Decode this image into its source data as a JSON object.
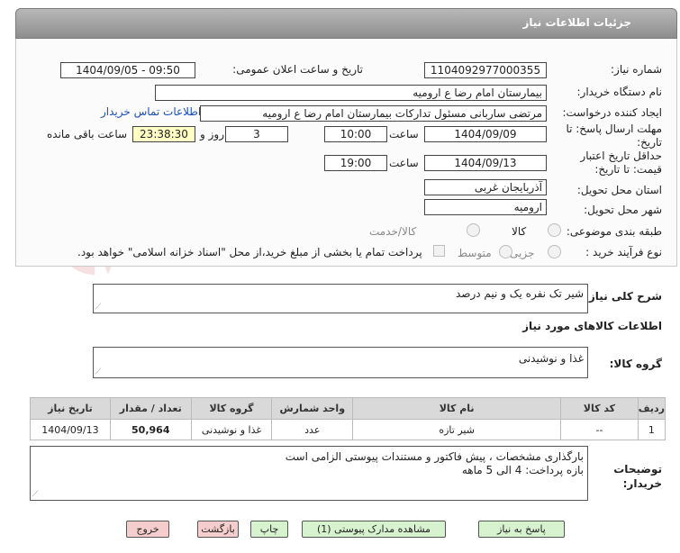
{
  "header": {
    "title": "جزئیات اطلاعات نیاز"
  },
  "fields": {
    "need_number_label": "شماره نیاز:",
    "need_number": "1104092977000355",
    "announce_label": "تاریخ و ساعت اعلان عمومی:",
    "announce_value": "1404/09/05 - 09:50",
    "buyer_org_label": "نام دستگاه خریدار:",
    "buyer_org": "بیمارستان امام رضا  ع  ارومیه",
    "creator_label": "ایجاد کننده درخواست:",
    "creator": "مرتضی ساربانی مسئول تدارکات بیمارستان امام رضا  ع  ارومیه",
    "contact_link": "اطلاعات تماس خریدار",
    "deadline_label_1": "مهلت ارسال پاسخ: تا",
    "deadline_label_2": "تاریخ:",
    "deadline_date": "1404/09/09",
    "time_label": "ساعت",
    "deadline_time": "10:00",
    "days": "3",
    "days_label": "روز و",
    "remaining": "23:38:30",
    "remaining_label": "ساعت باقی مانده",
    "validity_label_1": "حداقل تاریخ اعتبار",
    "validity_label_2": "قیمت: تا تاریخ:",
    "validity_date": "1404/09/13",
    "validity_time": "19:00",
    "province_label": "استان محل تحویل:",
    "province": "آذربایجان غربی",
    "city_label": "شهر محل تحویل:",
    "city": "ارومیه",
    "category_label": "طبقه بندی موضوعی:",
    "category_options": [
      "کالا",
      "کالا/خدمت"
    ],
    "process_label": "نوع فرآیند خرید :",
    "process_options": [
      "جزیی",
      "متوسط"
    ],
    "payment_note": "پرداخت تمام یا بخشی از مبلغ خرید،از محل \"اسناد خزانه اسلامی\" خواهد بود."
  },
  "summary": {
    "label": "شرح کلی نیاز:",
    "text": "شیر تک نفره یک و نیم درصد"
  },
  "goods": {
    "section_title": "اطلاعات کالاهای مورد نیاز",
    "group_label": "گروه کالا:",
    "group_value": "غذا و نوشیدنی"
  },
  "table": {
    "headers": [
      "ردیف",
      "کد کالا",
      "نام کالا",
      "واحد شمارش",
      "گروه کالا",
      "تعداد / مقدار",
      "تاریخ نیاز"
    ],
    "rows": [
      [
        "1",
        "--",
        "شیر تازه",
        "عدد",
        "غذا و نوشیدنی",
        "50,964",
        "1404/09/13"
      ]
    ]
  },
  "notes": {
    "label_1": "توضیحات",
    "label_2": "خریدار:",
    "line1": "بارگذاری مشخصات ، پیش فاکتور و مستندات پیوستی الزامی است",
    "line2": "بازه پرداخت: 4 الی 5 ماهه"
  },
  "buttons": {
    "reply": "پاسخ به نیاز",
    "attachments": "مشاهده مدارک پیوستی (1)",
    "print": "چاپ",
    "back": "بازگشت",
    "exit": "خروج"
  },
  "watermark": "AriaTender.neT",
  "colors": {
    "header": "#9e9e9e",
    "link": "#1b4fb5",
    "remaining_bg": "#ffffc6",
    "button_green": "#d7f2cf",
    "button_red": "#f6cdcd"
  }
}
